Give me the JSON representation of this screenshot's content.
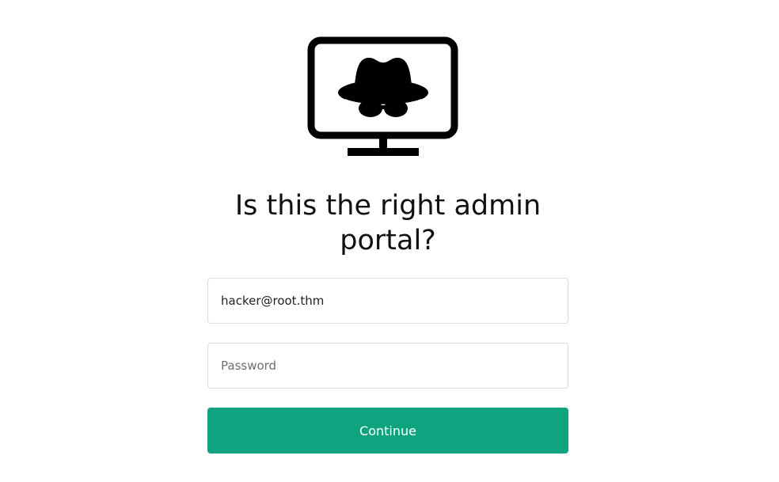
{
  "logo": {
    "icon": "incognito-monitor-icon",
    "color": "#000000"
  },
  "heading": {
    "line1": "Is this the right admin",
    "line2": "portal?"
  },
  "form": {
    "email_value": "hacker@root.thm",
    "password_placeholder": "Password",
    "continue_label": "Continue"
  },
  "colors": {
    "accent": "#10a37f",
    "button_text": "#ffffff",
    "border": "#dcdcdc"
  }
}
